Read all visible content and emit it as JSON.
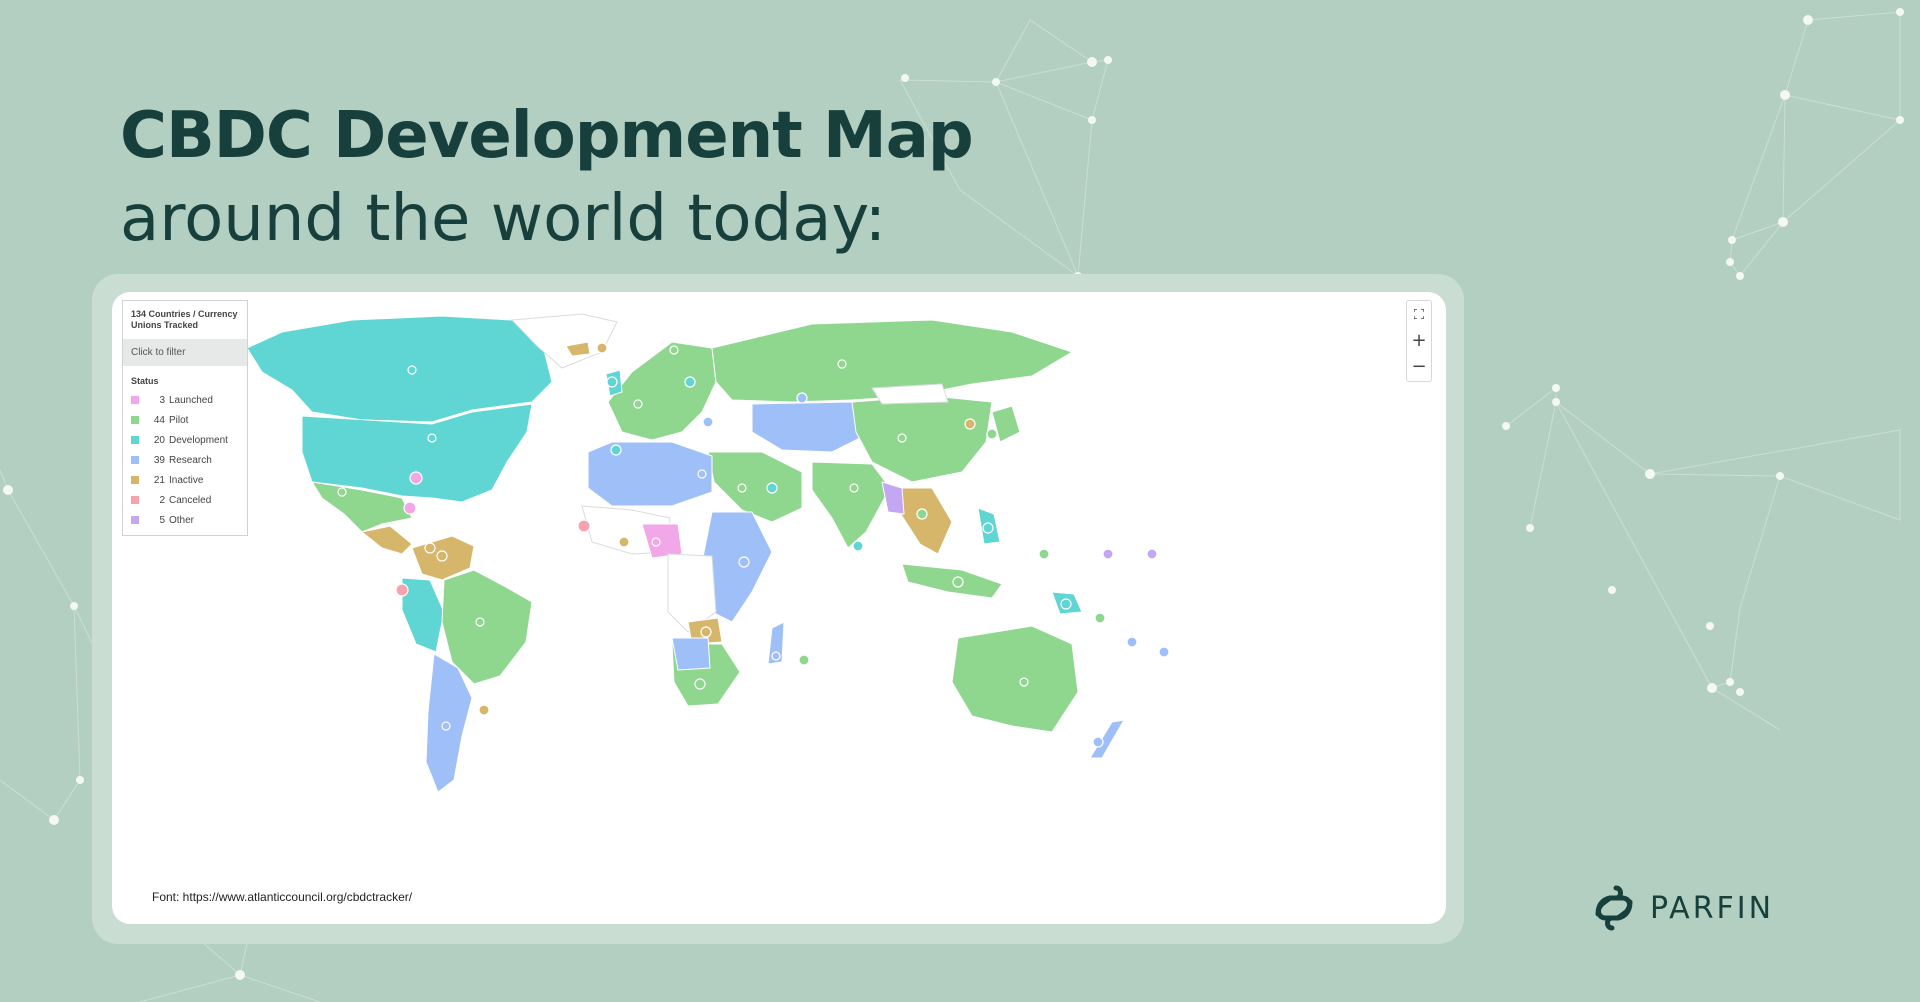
{
  "page": {
    "title": "CBDC Development Map",
    "subtitle": "around the world today:"
  },
  "legend": {
    "header": "134 Countries / Currency Unions Tracked",
    "filter_label": "Click to filter",
    "status_label": "Status",
    "items": [
      {
        "count": "3",
        "label": "Launched",
        "color": "#f2a7e8"
      },
      {
        "count": "44",
        "label": "Pilot",
        "color": "#8fd68f"
      },
      {
        "count": "20",
        "label": "Development",
        "color": "#5fd6d3"
      },
      {
        "count": "39",
        "label": "Research",
        "color": "#9fbff8"
      },
      {
        "count": "21",
        "label": "Inactive",
        "color": "#d5b66b"
      },
      {
        "count": "2",
        "label": "Canceled",
        "color": "#f7a3ad"
      },
      {
        "count": "5",
        "label": "Other",
        "color": "#c3a7f2"
      }
    ]
  },
  "controls": {
    "fullscreen_icon": "fullscreen-icon",
    "zoom_in": "+",
    "zoom_out": "−"
  },
  "source": "Font: https://www.atlanticcouncil.org/cbdctracker/",
  "brand": {
    "name": "PARFIN",
    "logo_icon": "parfin-logo-icon"
  }
}
